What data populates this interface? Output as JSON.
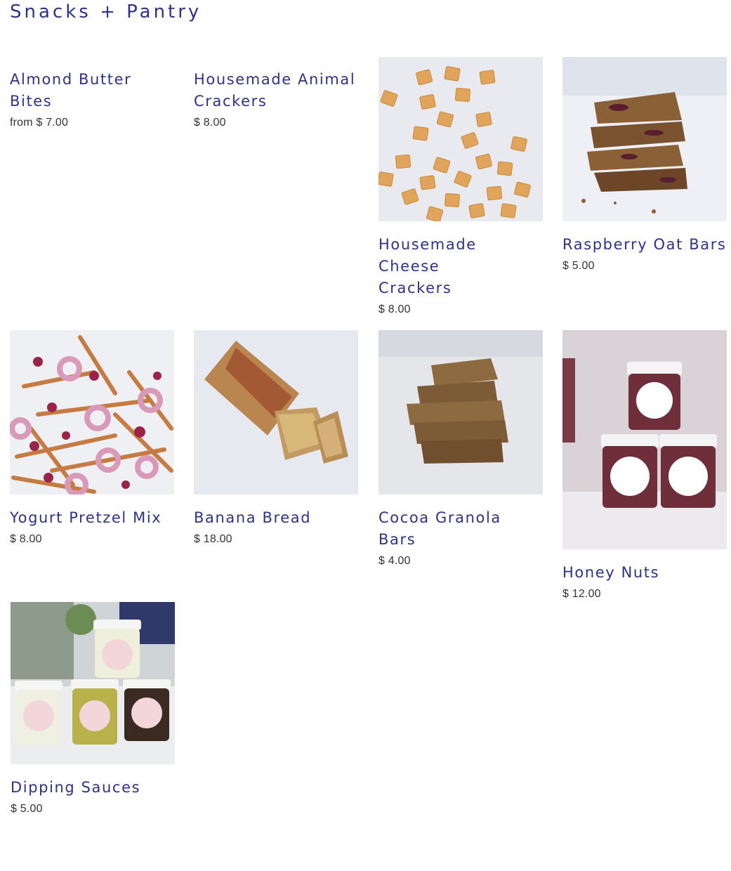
{
  "page": {
    "title": "Snacks + Pantry"
  },
  "products": [
    {
      "name": "Almond Butter Bites",
      "name_line1": "Almond Butter",
      "name_line2": "Bites",
      "price": "from $ 7.00",
      "has_image": false
    },
    {
      "name": "Housemade Animal Crackers",
      "name_line1": "Housemade Animal",
      "name_line2": "Crackers",
      "price": "$ 8.00",
      "has_image": false
    },
    {
      "name": "Housemade Cheese Crackers",
      "name_line1": "Housemade Cheese",
      "name_line2": "Crackers",
      "price": "$ 8.00",
      "has_image": true,
      "image_desc": "cheese-crackers"
    },
    {
      "name": "Raspberry Oat Bars",
      "name_line1": "Raspberry Oat Bars",
      "price": "$ 5.00",
      "has_image": true,
      "image_desc": "oat-bars"
    },
    {
      "name": "Yogurt Pretzel Mix",
      "name_line1": "Yogurt Pretzel Mix",
      "price": "$ 8.00",
      "has_image": true,
      "image_desc": "pretzel-mix"
    },
    {
      "name": "Banana Bread",
      "name_line1": "Banana Bread",
      "price": "$ 18.00",
      "has_image": true,
      "image_desc": "banana-bread"
    },
    {
      "name": "Cocoa Granola Bars",
      "name_line1": "Cocoa Granola Bars",
      "price": "$ 4.00",
      "has_image": true,
      "image_desc": "granola-bars"
    },
    {
      "name": "Honey Nuts",
      "name_line1": "Honey Nuts",
      "price": "$ 12.00",
      "has_image": true,
      "image_desc": "honey-nuts-jars"
    },
    {
      "name": "Dipping Sauces",
      "name_line1": "Dipping Sauces",
      "price": "$ 5.00",
      "has_image": true,
      "image_desc": "dipping-sauce-jars"
    }
  ],
  "colors": {
    "accent": "#2e3192",
    "price_text": "#333333"
  }
}
